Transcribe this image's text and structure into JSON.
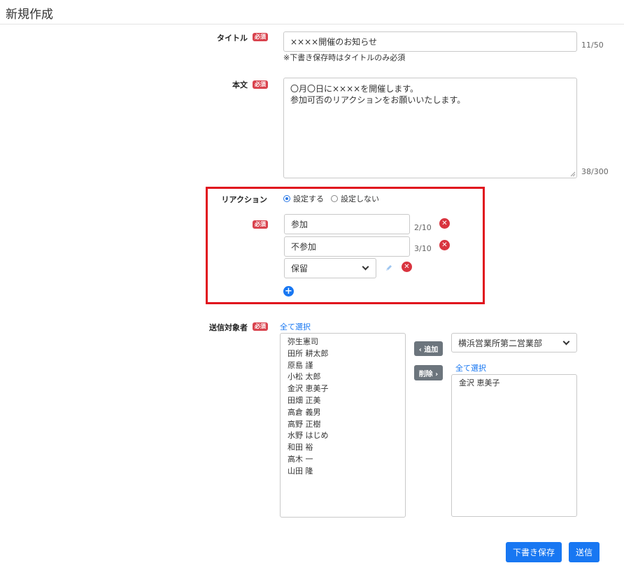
{
  "page": {
    "title": "新規作成"
  },
  "required_badge": "必須",
  "title_field": {
    "label": "タイトル",
    "value": "××××開催のお知らせ",
    "counter": "11/50",
    "note": "※下書き保存時はタイトルのみ必須"
  },
  "body_field": {
    "label": "本文",
    "value": "〇月〇日に××××を開催します。\n参加可否のリアクションをお願いいたします。",
    "counter": "38/300"
  },
  "reaction": {
    "label": "リアクション",
    "options": [
      "設定する",
      "設定しない"
    ],
    "selected": "設定する",
    "items": [
      {
        "value": "参加",
        "counter": "2/10"
      },
      {
        "value": "不参加",
        "counter": "3/10"
      }
    ],
    "select_value": "保留",
    "highlight_color": "#e0111d"
  },
  "recipients": {
    "label": "送信対象者",
    "select_all_left": "全て選択",
    "available": [
      "弥生憲司",
      "田所 耕太郎",
      "原島 謹",
      "小松 太郎",
      "金沢 恵美子",
      "田畑 正美",
      "高倉 義男",
      "高野 正樹",
      "水野 はじめ",
      "和田 裕",
      "高木 一",
      "山田 隆"
    ],
    "add_button": "‹ 追加",
    "remove_button": "削除 ›",
    "department": "横浜営業所第二営業部",
    "select_all_right": "全て選択",
    "selected": [
      "金沢 恵美子"
    ]
  },
  "footer": {
    "draft_button": "下書き保存",
    "send_button": "送信"
  },
  "colors": {
    "accent": "#1877f2",
    "danger": "#d9343f",
    "badge": "#d9434e",
    "secondary": "#6c757d"
  }
}
